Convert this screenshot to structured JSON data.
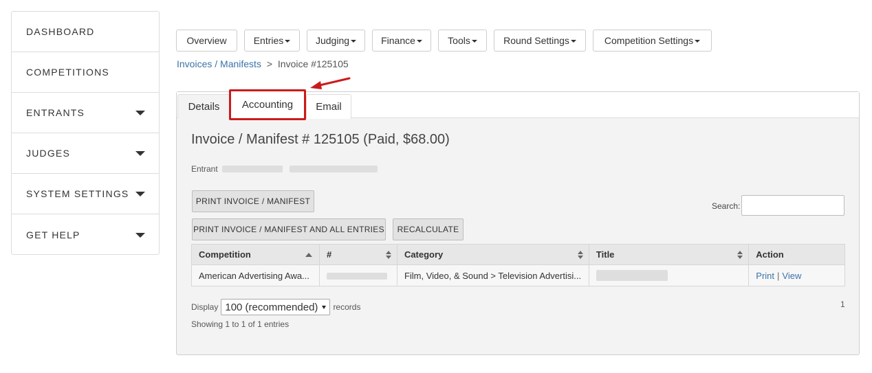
{
  "sidebar": {
    "items": [
      {
        "label": "DASHBOARD",
        "has_submenu": false
      },
      {
        "label": "COMPETITIONS",
        "has_submenu": false
      },
      {
        "label": "ENTRANTS",
        "has_submenu": true
      },
      {
        "label": "JUDGES",
        "has_submenu": true
      },
      {
        "label": "SYSTEM SETTINGS",
        "has_submenu": true
      },
      {
        "label": "GET HELP",
        "has_submenu": true
      }
    ]
  },
  "topnav": {
    "items": [
      {
        "label": "Overview",
        "dropdown": false
      },
      {
        "label": "Entries",
        "dropdown": true
      },
      {
        "label": "Judging",
        "dropdown": true
      },
      {
        "label": "Finance",
        "dropdown": true
      },
      {
        "label": "Tools",
        "dropdown": true
      },
      {
        "label": "Round Settings",
        "dropdown": true
      },
      {
        "label": "Competition Settings",
        "dropdown": true
      }
    ]
  },
  "breadcrumb": {
    "link": "Invoices / Manifests",
    "separator": ">",
    "current": "Invoice #125105"
  },
  "tabs": [
    {
      "label": "Details",
      "active": true
    },
    {
      "label": "Accounting",
      "highlighted": true
    },
    {
      "label": "Email"
    }
  ],
  "invoice": {
    "title": "Invoice / Manifest # 125105 (Paid, $68.00)",
    "entrant_label": "Entrant"
  },
  "actions": {
    "print": "PRINT INVOICE / MANIFEST",
    "print_all": "PRINT INVOICE / MANIFEST AND ALL ENTRIES",
    "recalculate": "RECALCULATE"
  },
  "search": {
    "label": "Search:",
    "value": ""
  },
  "table": {
    "columns": [
      "Competition",
      "#",
      "Category",
      "Title",
      "Action"
    ],
    "rows": [
      {
        "competition": "American Advertising Awa...",
        "category": "Film, Video, & Sound > Television Advertisi...",
        "actions": [
          "Print",
          "View"
        ],
        "action_separator": "|"
      }
    ]
  },
  "footer": {
    "display_label": "Display",
    "display_value": "100 (recommended)",
    "records_label": "records",
    "showing": "Showing 1 to 1 of 1 entries",
    "page": "1"
  },
  "colors": {
    "link": "#3a73a8",
    "highlight": "#cc1a1a",
    "panel_bg": "#f3f3f3",
    "button_bg": "#e2e2e2"
  }
}
